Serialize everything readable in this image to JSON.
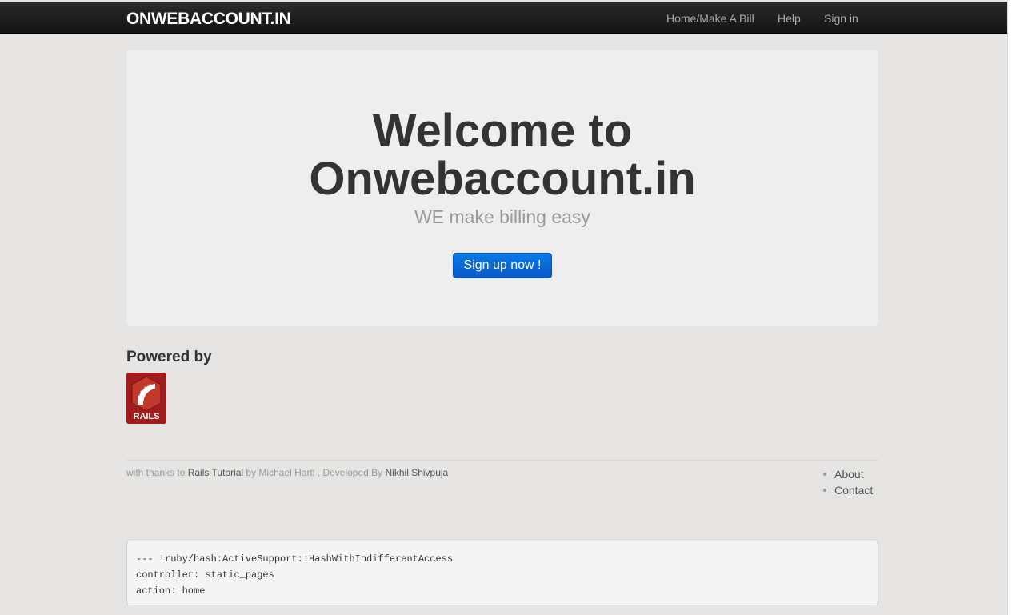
{
  "header": {
    "brand": "ONWEBACCOUNT.IN",
    "nav": [
      {
        "label": "Home/Make A Bill"
      },
      {
        "label": "Help"
      },
      {
        "label": "Sign in"
      }
    ]
  },
  "hero": {
    "title_line1": "Welcome to",
    "title_line2": "Onwebaccount.in",
    "tagline": "WE make billing easy",
    "signup_label": "Sign up now !"
  },
  "powered": {
    "heading": "Powered by",
    "logo_text": "RAILS"
  },
  "footer": {
    "thanks_prefix": "with thanks to",
    "tutorial_link": "Rails Tutorial",
    "by_text": "by Michael Hartl , Developed By",
    "developer_link": "Nikhil Shivpuja",
    "links": [
      {
        "label": "About"
      },
      {
        "label": "Contact"
      }
    ]
  },
  "debug": {
    "lines": [
      "--- !ruby/hash:ActiveSupport::HashWithIndifferentAccess",
      "controller: static_pages",
      "action: home"
    ]
  }
}
